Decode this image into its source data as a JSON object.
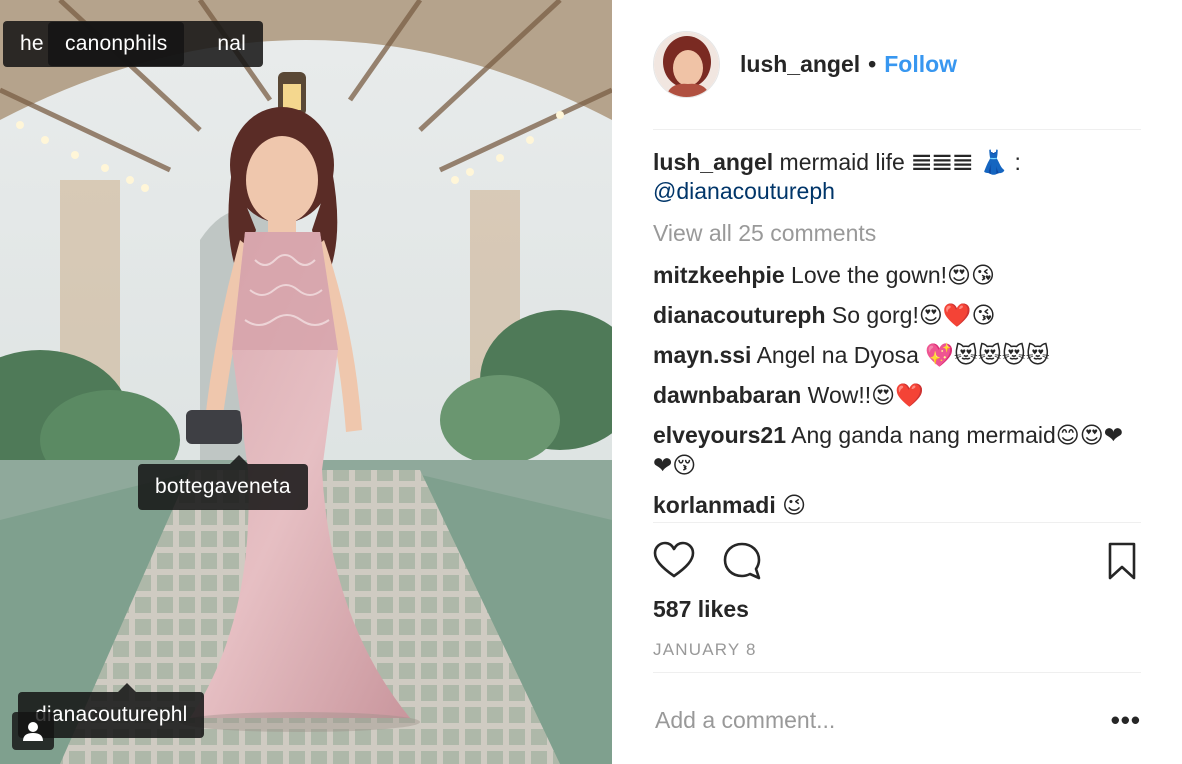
{
  "photo": {
    "tags": [
      {
        "label": "he",
        "layer": "back"
      },
      {
        "label": "nal",
        "layer": "back"
      },
      {
        "label": "canonphils",
        "layer": "front"
      },
      {
        "label": "bottegaveneta",
        "layer": "front"
      },
      {
        "label": "dianacouturephl",
        "layer": "front"
      }
    ],
    "user_tags_icon": "person-icon"
  },
  "post": {
    "owner": "lush_angel",
    "separator": "•",
    "follow_label": "Follow",
    "caption": {
      "username": "lush_angel",
      "text": "mermaid life 𝌆𝌆𝌆 👗 :",
      "mention": "@dianacoutureph"
    },
    "view_all": "View all 25 comments",
    "comments": [
      {
        "user": "mitzkeehpie",
        "text": "Love the gown!😍😘"
      },
      {
        "user": "dianacoutureph",
        "text": "So gorg!😍❤️😘"
      },
      {
        "user": "mayn.ssi",
        "text": "Angel na Dyosa 💖😻😻😻😻"
      },
      {
        "user": "dawnbabaran",
        "text": "Wow!!😍❤️"
      },
      {
        "user": "elveyours21",
        "text": "Ang ganda nang mermaid😊😍❤❤😚"
      },
      {
        "user": "korlanmadi",
        "text": "😉"
      }
    ],
    "likes": "587 likes",
    "date": "JANUARY 8",
    "add_comment_placeholder": "Add a comment...",
    "more_label": "•••"
  },
  "colors": {
    "accent": "#3897f0",
    "mention": "#003569",
    "muted": "#999999",
    "text": "#262626"
  },
  "icons": [
    "heart-icon",
    "comment-icon",
    "bookmark-icon",
    "person-icon"
  ]
}
